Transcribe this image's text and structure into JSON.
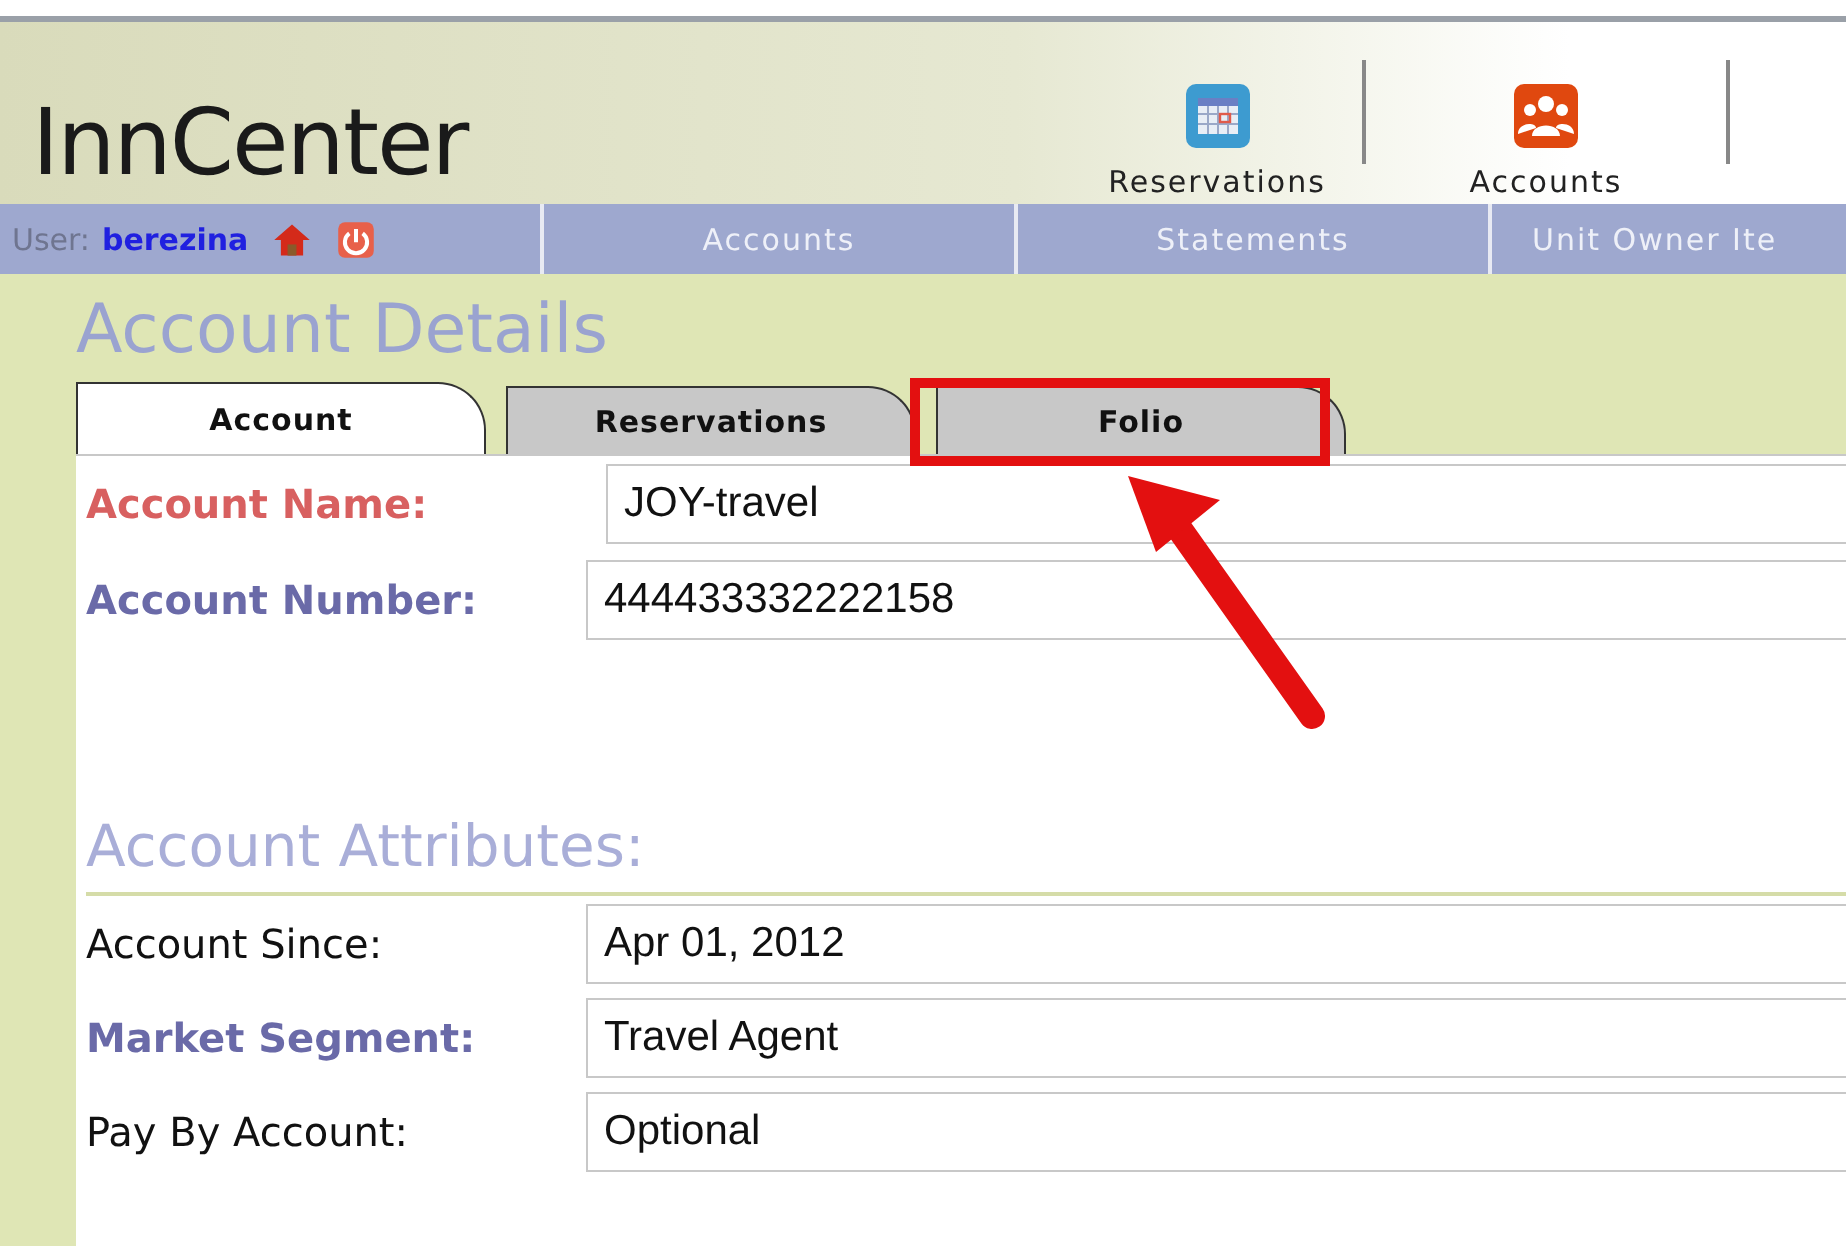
{
  "logo": {
    "text": "InnCenter"
  },
  "toolbar": [
    {
      "label": "Reservations",
      "kind": "calendar"
    },
    {
      "label": "Accounts",
      "kind": "people"
    }
  ],
  "user": {
    "label": "User:",
    "name": "berezina"
  },
  "nav": [
    "Accounts",
    "Statements",
    "Unit Owner Ite"
  ],
  "page_title": "Account Details",
  "tabs": [
    {
      "label": "Account",
      "selected": true
    },
    {
      "label": "Reservations",
      "selected": false
    },
    {
      "label": "Folio",
      "selected": false
    }
  ],
  "fields": [
    {
      "label": "Account Name:",
      "value": "JOY-travel",
      "kind": "required"
    },
    {
      "label": "Account Number:",
      "value": "444433332222158",
      "kind": "important"
    }
  ],
  "section_title": "Account Attributes:",
  "attributes": [
    {
      "label": "Account Since:",
      "value": "Apr 01, 2012",
      "kind": "plain"
    },
    {
      "label": "Market Segment:",
      "value": "Travel Agent",
      "kind": "important"
    },
    {
      "label": "Pay By Account:",
      "value": "Optional",
      "kind": "plain"
    }
  ]
}
